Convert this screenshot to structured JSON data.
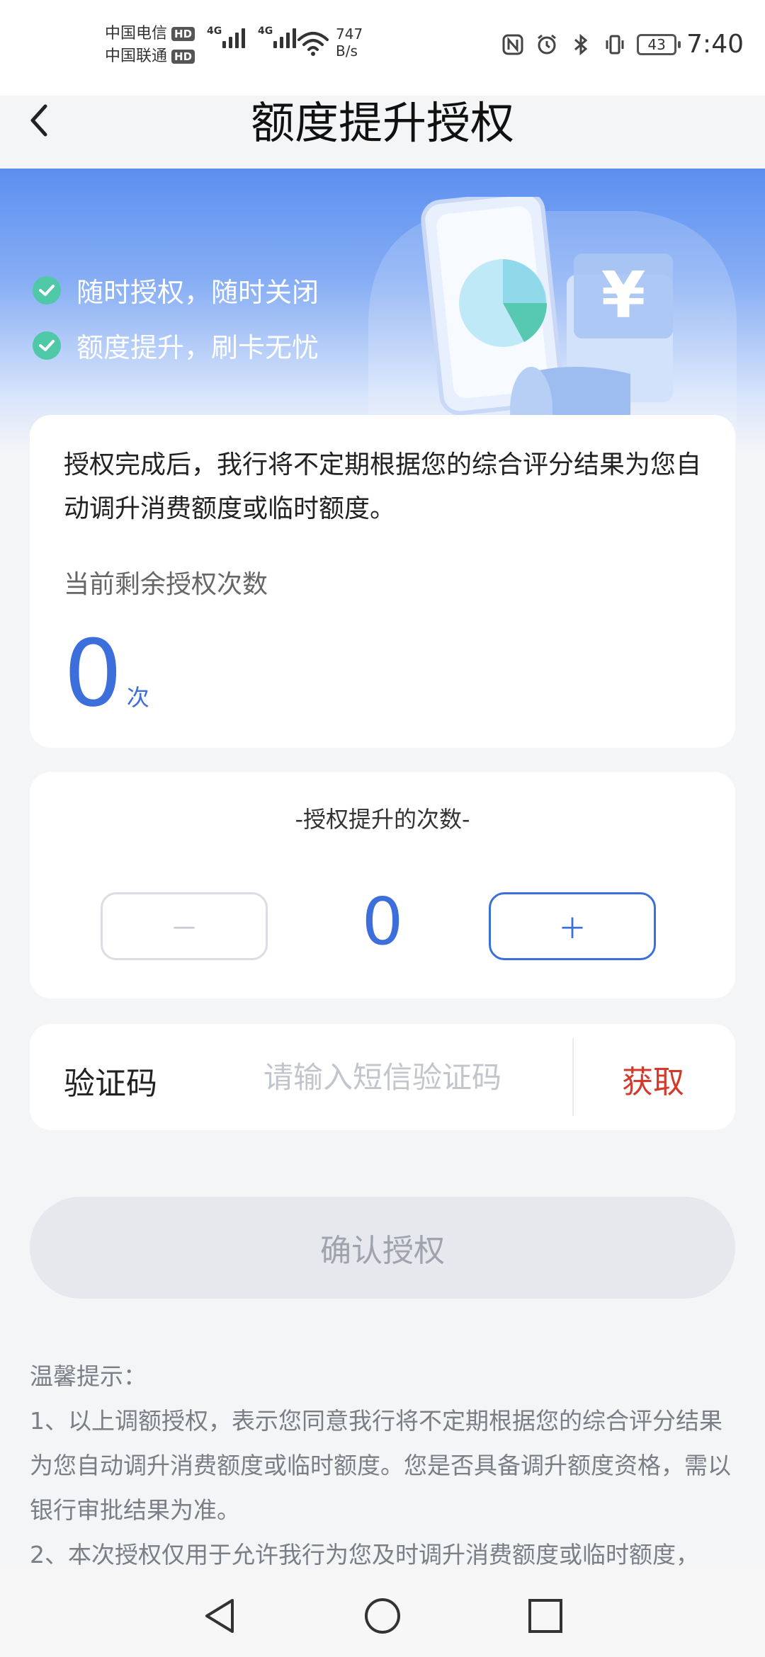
{
  "status_bar": {
    "carrier1": "中国电信",
    "carrier2": "中国联通",
    "hd": "HD",
    "network1": "4G",
    "network2": "4G",
    "speed_value": "747",
    "speed_unit": "B/s",
    "battery": "43",
    "time": "7:40",
    "icons": [
      "nfc-icon",
      "alarm-icon",
      "bluetooth-icon",
      "vibrate-icon",
      "battery-icon"
    ]
  },
  "header": {
    "title": "额度提升授权"
  },
  "banner": {
    "features": [
      "随时授权，随时关闭",
      "额度提升，刷卡无忧"
    ],
    "colors": {
      "check": "#4fc8a8",
      "gradient_top": "#5b8ff0"
    }
  },
  "info_card": {
    "description": "授权完成后，我行将不定期根据您的综合评分结果为您自动调升消费额度或临时额度。",
    "remaining_label": "当前剩余授权次数",
    "remaining_count": "0",
    "remaining_unit": "次"
  },
  "stepper_card": {
    "title": "-授权提升的次数-",
    "minus_label": "－",
    "value": "0",
    "plus_label": "＋"
  },
  "verify_card": {
    "label": "验证码",
    "placeholder": "请输入短信验证码",
    "get_label": "获取"
  },
  "confirm": {
    "label": "确认授权"
  },
  "tips": {
    "title": "温馨提示：",
    "item1": "1、以上调额授权，表示您同意我行将不定期根据您的综合评分结果为您自动调升消费额度或临时额度。您是否具备调升额度资格，需以银行审批结果为准。",
    "item2": "2、本次授权仅用于允许我行为您及时调升消费额度或临时额度，"
  },
  "theme": {
    "primary": "#3c6fdc",
    "danger": "#d33a2c",
    "disabled_bg": "#e6e8ee"
  }
}
